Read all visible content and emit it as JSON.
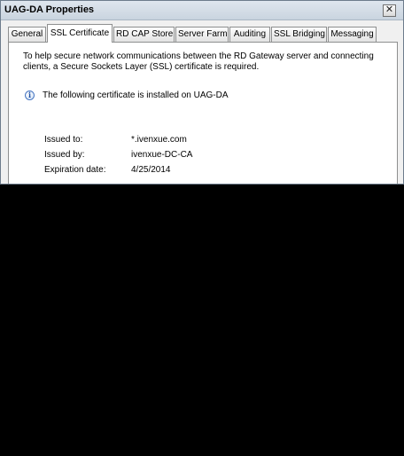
{
  "window": {
    "title": "UAG-DA Properties",
    "close_glyph": "✕"
  },
  "tabs": [
    {
      "label": "General"
    },
    {
      "label": "SSL Certificate",
      "active": true
    },
    {
      "label": "RD CAP Store"
    },
    {
      "label": "Server Farm"
    },
    {
      "label": "Auditing"
    },
    {
      "label": "SSL Bridging"
    },
    {
      "label": "Messaging"
    }
  ],
  "panel": {
    "intro": "To help secure network communications between the RD Gateway server and connecting clients, a Secure Sockets Layer (SSL) certificate is required.",
    "info_icon": "info-icon",
    "info_text": "The following certificate is installed on UAG-DA",
    "fields": [
      {
        "label": "Issued to:",
        "value": "*.ivenxue.com"
      },
      {
        "label": "Issued by:",
        "value": "ivenxue-DC-CA"
      },
      {
        "label": "Expiration date:",
        "value": "4/25/2014"
      }
    ]
  },
  "colors": {
    "background": "#000000",
    "window_face": "#f0f0f0",
    "panel": "#ffffff",
    "info_blue": "#1f4fa3"
  }
}
